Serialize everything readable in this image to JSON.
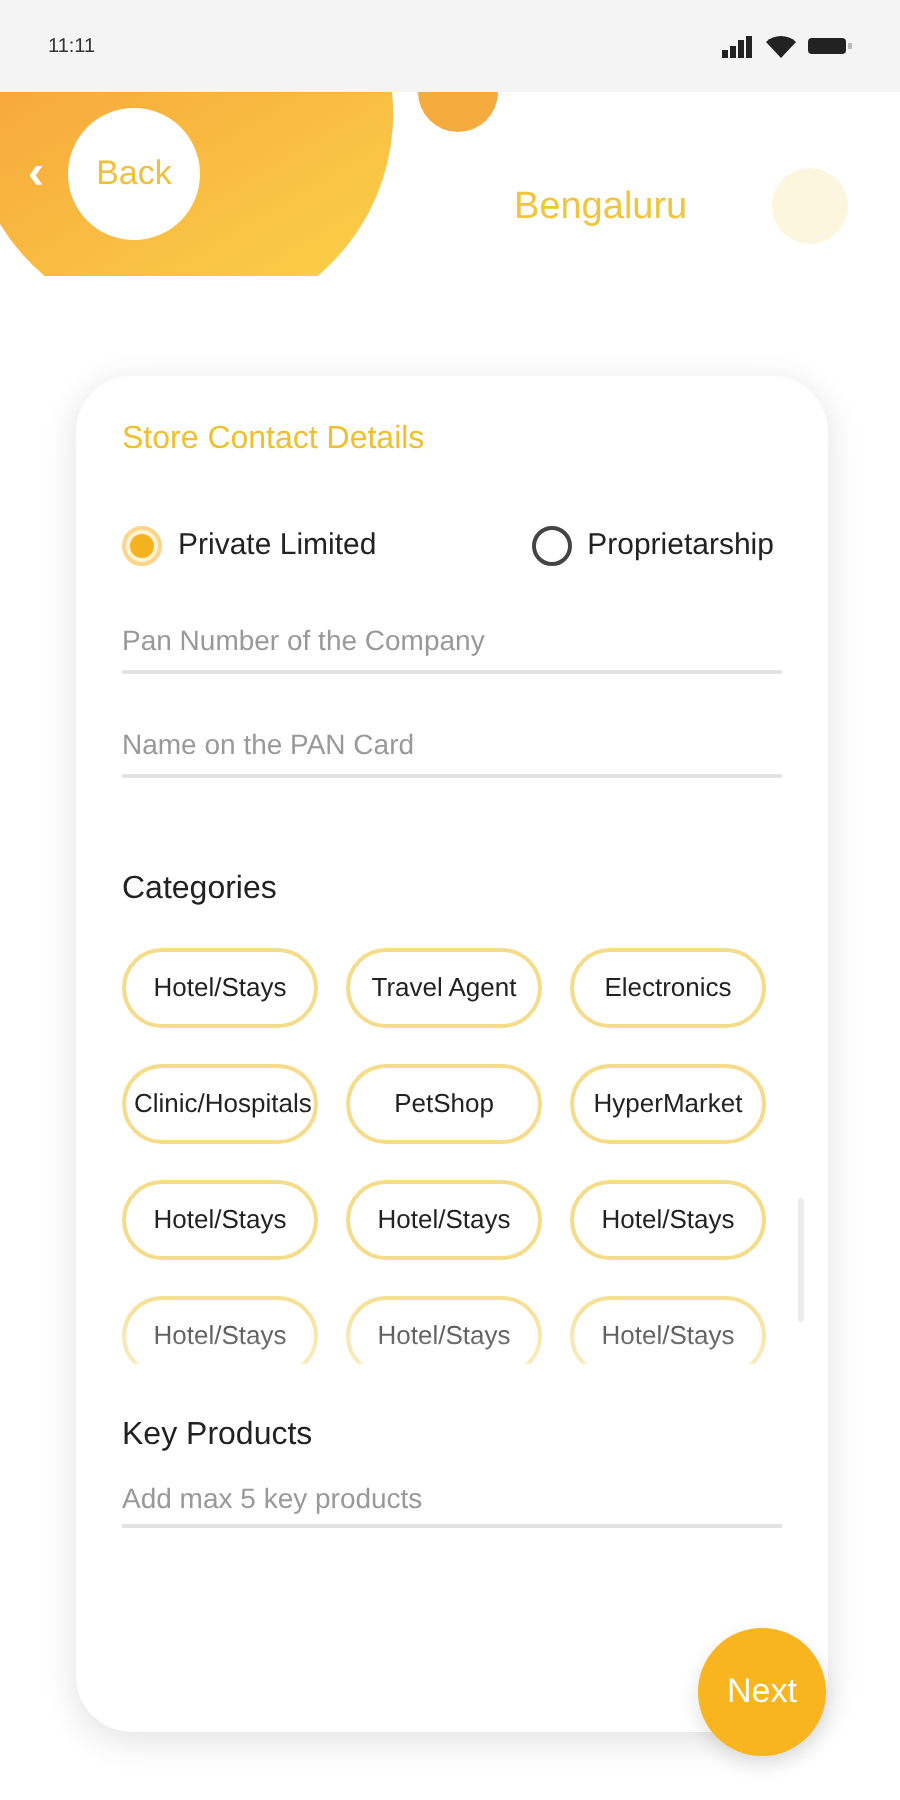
{
  "status_bar": {
    "time": "11:11"
  },
  "header": {
    "back": {
      "label": "Back",
      "icon": "‹"
    },
    "city": "Bengaluru"
  },
  "form": {
    "title": "Store Contact Details",
    "company_types": [
      {
        "label": "Private Limited",
        "selected": true
      },
      {
        "label": "Proprietarship",
        "selected": false
      }
    ],
    "fields": [
      {
        "placeholder": "Pan Number of the Company"
      },
      {
        "placeholder": "Name on the PAN Card"
      }
    ],
    "categories": {
      "title": "Categories",
      "items": [
        {
          "label": "Hotel/Stays"
        },
        {
          "label": "Travel Agent"
        },
        {
          "label": "Electronics"
        },
        {
          "label": "Clinic/Hospitals"
        },
        {
          "label": "PetShop"
        },
        {
          "label": "HyperMarket"
        },
        {
          "label": "Hotel/Stays"
        },
        {
          "label": "Hotel/Stays"
        },
        {
          "label": "Hotel/Stays"
        },
        {
          "label": "Hotel/Stays"
        },
        {
          "label": "Hotel/Stays"
        },
        {
          "label": "Hotel/Stays"
        }
      ]
    },
    "key_products": {
      "title": "Key Products",
      "placeholder": "Add max 5 key products"
    }
  },
  "next_button": {
    "label": "Next"
  }
}
